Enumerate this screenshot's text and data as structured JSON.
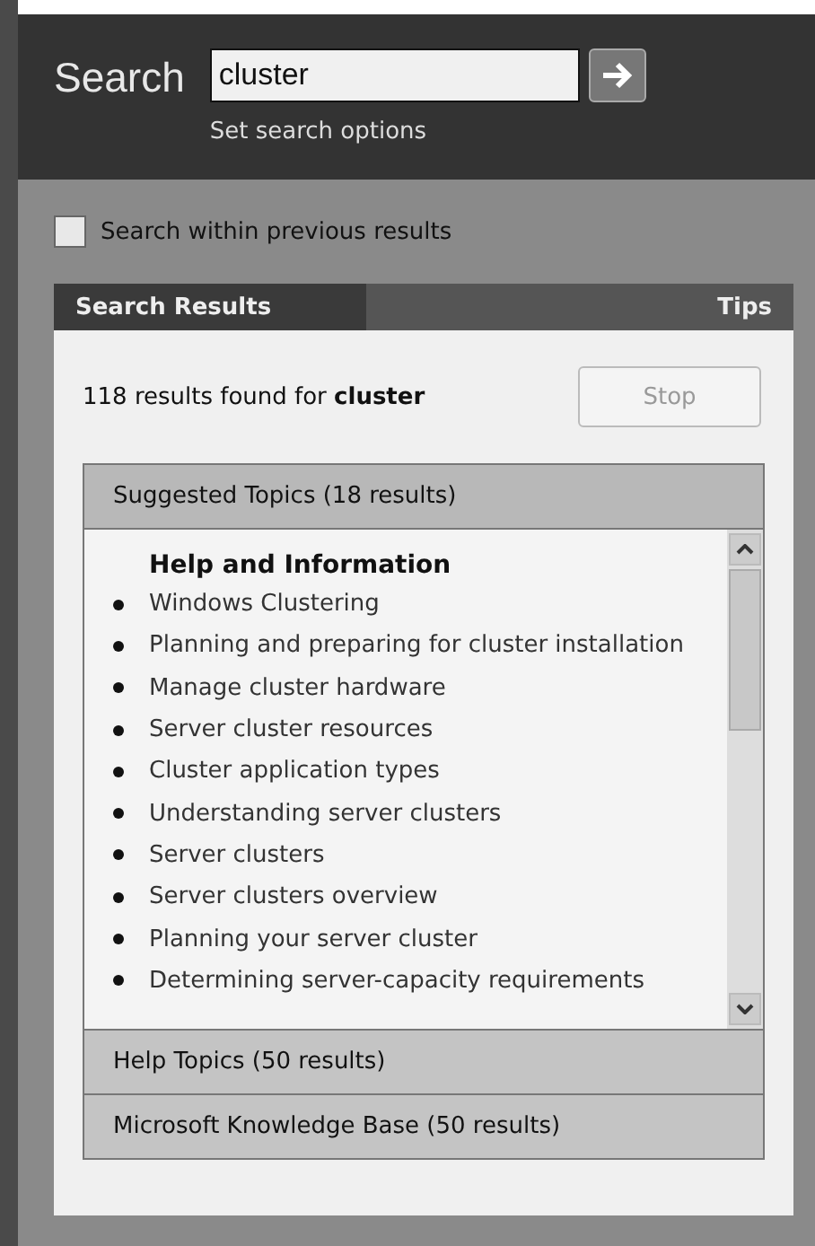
{
  "search": {
    "label": "Search",
    "value": "cluster",
    "options_link": "Set search options"
  },
  "within_previous": {
    "label": "Search within previous results",
    "checked": false
  },
  "tabs": [
    {
      "label": "Search Results",
      "selected": true
    },
    {
      "label": "Tips",
      "selected": false
    }
  ],
  "results": {
    "summary": "118 results found for **cluster**",
    "stop_button": {
      "label": "Stop",
      "disabled": true
    }
  },
  "sections": [
    {
      "title": "Suggested Topics (18 results)",
      "expanded": true,
      "heading": "Help and Information",
      "items": [
        "Windows Clustering",
        "Planning and preparing for cluster installation",
        "Manage cluster hardware",
        "Server cluster resources",
        "Cluster application types",
        "Understanding server clusters",
        "Server clusters",
        "Server clusters overview",
        "Planning your server cluster",
        "Determining server-capacity requirements"
      ]
    },
    {
      "title": "Help Topics (50 results)",
      "expanded": false
    },
    {
      "title": "Microsoft Knowledge Base (50 results)",
      "expanded": false
    }
  ]
}
